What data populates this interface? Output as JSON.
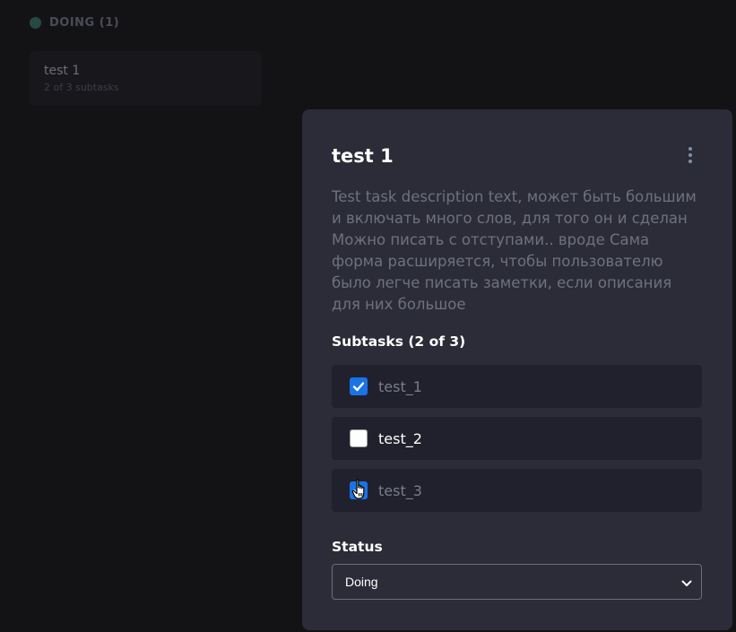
{
  "board": {
    "column": {
      "title": "DOING (1)",
      "dot_color": "#3f8f76"
    },
    "card": {
      "title": "test 1",
      "subtitle": "2 of 3 subtasks"
    }
  },
  "modal": {
    "title": "test 1",
    "description": "Test task description text, может быть большим и включать много слов, для того он и сделан Можно писать с отступами.. вроде Сама форма расширяется, чтобы пользователю было легче писать заметки, если описания для них большое",
    "subtasks_label": "Subtasks (2 of 3)",
    "subtasks": [
      {
        "label": "test_1",
        "checked": true
      },
      {
        "label": "test_2",
        "checked": false
      },
      {
        "label": "test_3",
        "checked": true
      }
    ],
    "status_label": "Status",
    "status_value": "Doing",
    "menu_icon": "vertical-ellipsis-icon"
  },
  "colors": {
    "accent": "#1a73e8",
    "modal_bg": "#2b2c37",
    "subtask_bg": "#20212c",
    "page_bg": "#131316"
  }
}
